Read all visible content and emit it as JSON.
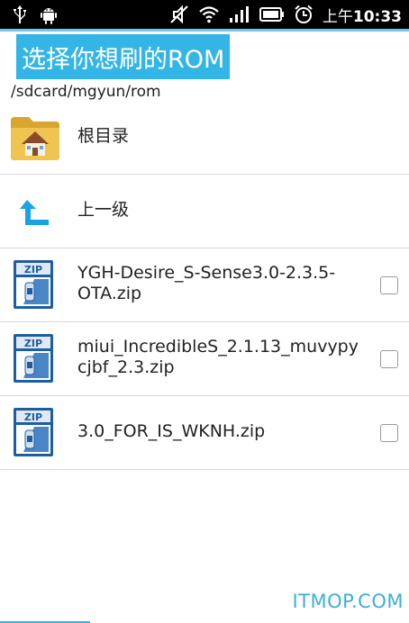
{
  "status_bar": {
    "time_prefix": "上午",
    "time": "10:33",
    "icons": [
      "usb-icon",
      "android-debug-icon",
      "mute-icon",
      "wifi-icon",
      "signal-icon",
      "battery-icon",
      "alarm-icon"
    ]
  },
  "header": {
    "title": "选择你想刷的ROM",
    "path": "/sdcard/mgyun/rom"
  },
  "list": {
    "root_label": "根目录",
    "up_label": "上一级",
    "files": [
      {
        "line1": "YGH-Desire_S-Sense3.0-2.3.5-",
        "line2": "OTA.zip",
        "checked": false
      },
      {
        "line1": "miui_IncredibleS_2.1.13_muvypy",
        "line2": "cjbf_2.3.zip",
        "checked": false
      },
      {
        "line1": "3.0_FOR_IS_WKNH.zip",
        "line2": "",
        "checked": false
      }
    ]
  },
  "watermark": "ITMOP.COM",
  "colors": {
    "accent": "#33b5e5",
    "status_bar": "#000000",
    "zip_icon": "#1f5e9e"
  }
}
